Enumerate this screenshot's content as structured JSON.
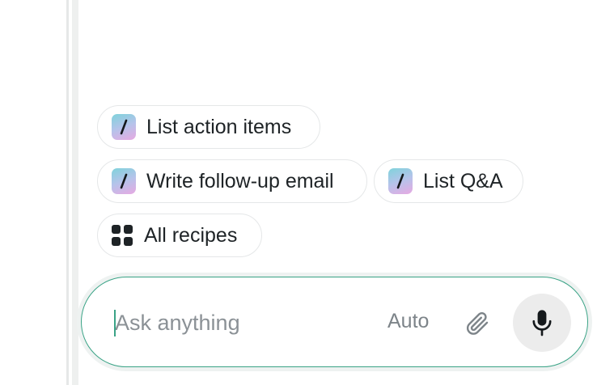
{
  "recipes": {
    "chips": [
      {
        "label": "List action items",
        "icon": "slash-command-icon"
      },
      {
        "label": "Write follow-up email",
        "icon": "slash-command-icon"
      },
      {
        "label": "List Q&A",
        "icon": "slash-command-icon"
      },
      {
        "label": "All recipes",
        "icon": "grid-icon"
      }
    ]
  },
  "composer": {
    "placeholder": "Ask anything",
    "value": "",
    "mode_label": "Auto",
    "attach_icon": "paperclip-icon",
    "mic_icon": "microphone-icon"
  },
  "colors": {
    "accent": "#3aa386",
    "chip_border": "#e5e7e8",
    "text": "#1e2326",
    "muted_text": "#7d8489",
    "mic_bg": "#ececec"
  }
}
